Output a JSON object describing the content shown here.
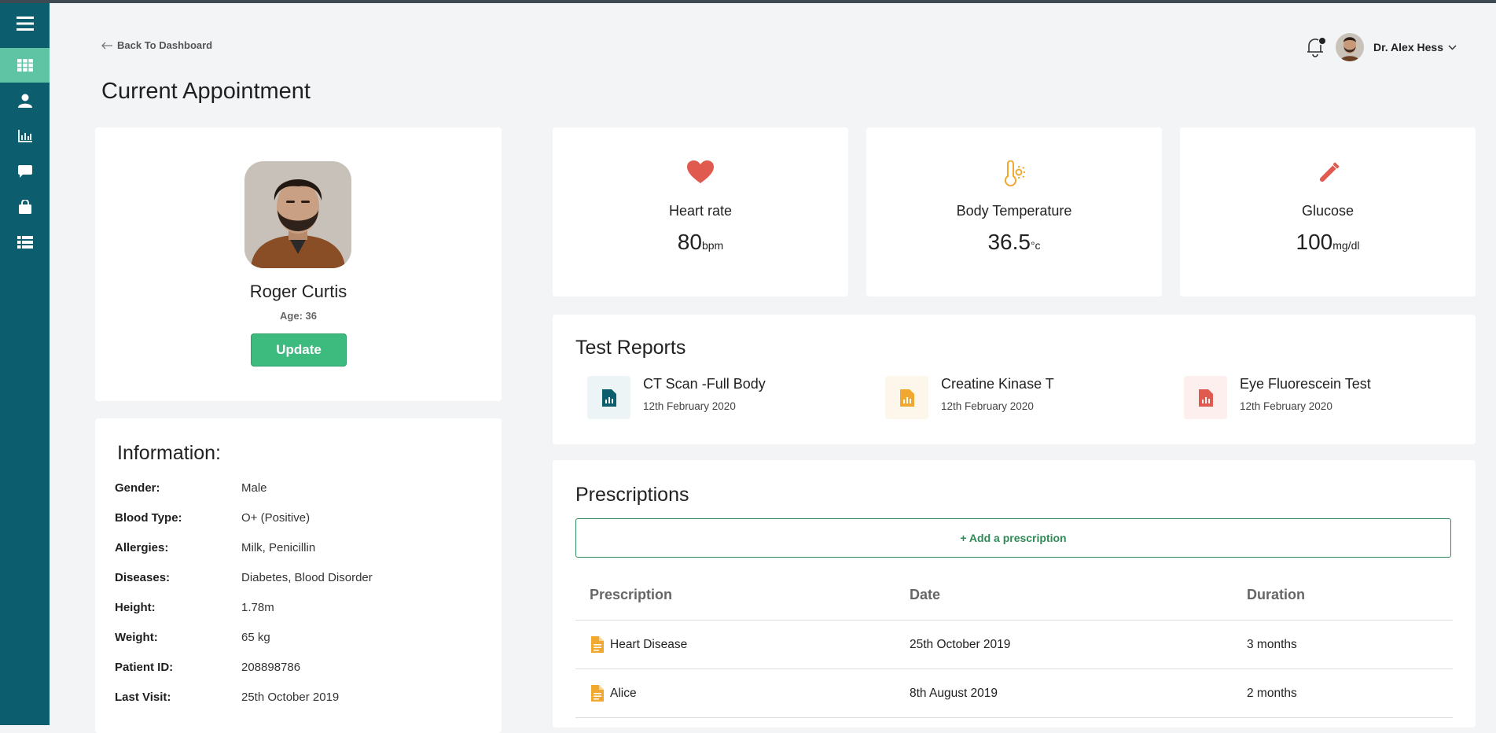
{
  "header": {
    "back_label": "Back To Dashboard",
    "page_title": "Current Appointment",
    "user_name": "Dr. Alex Hess"
  },
  "sidebar": {
    "items": [
      {
        "icon": "grid-icon",
        "active": true
      },
      {
        "icon": "user-icon",
        "active": false
      },
      {
        "icon": "bar-chart-icon",
        "active": false
      },
      {
        "icon": "chat-icon",
        "active": false
      },
      {
        "icon": "briefcase-icon",
        "active": false
      },
      {
        "icon": "list-icon",
        "active": false
      }
    ]
  },
  "patient": {
    "name": "Roger Curtis",
    "age": "Age: 36",
    "update_label": "Update"
  },
  "information": {
    "title": "Information:",
    "rows": [
      {
        "label": "Gender:",
        "value": "Male"
      },
      {
        "label": "Blood Type:",
        "value": "O+ (Positive)"
      },
      {
        "label": "Allergies:",
        "value": "Milk, Penicillin"
      },
      {
        "label": "Diseases:",
        "value": "Diabetes, Blood Disorder"
      },
      {
        "label": "Height:",
        "value": "1.78m"
      },
      {
        "label": "Weight:",
        "value": "65 kg"
      },
      {
        "label": "Patient ID:",
        "value": "208898786"
      },
      {
        "label": "Last Visit:",
        "value": "25th October 2019"
      }
    ]
  },
  "vitals": [
    {
      "name": "Heart rate",
      "value": "80",
      "unit": "bpm",
      "icon": "heart-icon",
      "color": "#e05a4f"
    },
    {
      "name": "Body Temperature",
      "value": "36.5",
      "unit": "°c",
      "icon": "thermometer-icon",
      "color": "#f0a830"
    },
    {
      "name": "Glucose",
      "value": "100",
      "unit": "mg/dl",
      "icon": "test-tube-icon",
      "color": "#e05a4f"
    }
  ],
  "test_reports": {
    "title": "Test Reports",
    "items": [
      {
        "name": "CT Scan -Full Body",
        "date": "12th February 2020",
        "color": "#0c5d6e"
      },
      {
        "name": "Creatine Kinase T",
        "date": "12th February 2020",
        "color": "#f0a830"
      },
      {
        "name": "Eye Fluorescein Test",
        "date": "12th February 2020",
        "color": "#e05a4f"
      }
    ]
  },
  "prescriptions": {
    "title": "Prescriptions",
    "add_label": "+ Add a prescription",
    "columns": [
      "Prescription",
      "Date",
      "Duration"
    ],
    "rows": [
      {
        "name": "Heart Disease",
        "date": "25th October 2019",
        "duration": "3 months"
      },
      {
        "name": "Alice",
        "date": "8th August 2019",
        "duration": "2 months"
      }
    ]
  },
  "colors": {
    "sidebar": "#0c5d6e",
    "accent": "#3dbb7f",
    "sidebar_active": "#5ec4a4"
  }
}
